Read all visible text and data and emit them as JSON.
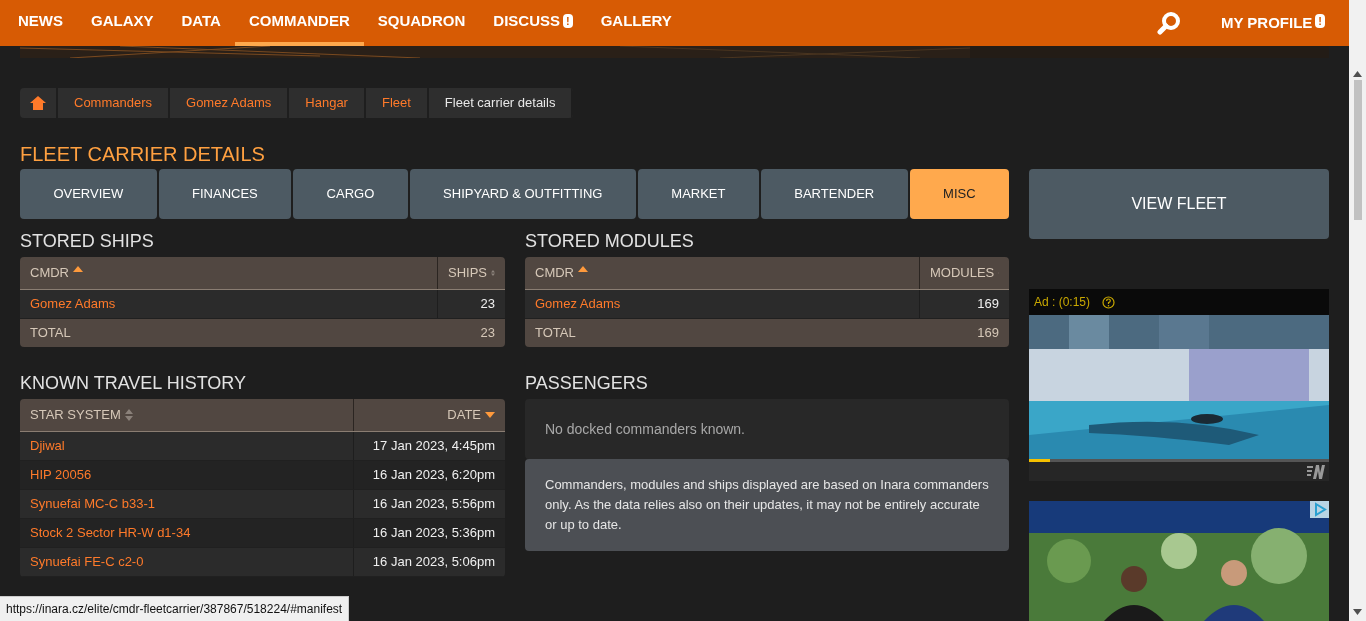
{
  "nav": {
    "items": [
      {
        "label": "NEWS",
        "selected": false,
        "alert": false
      },
      {
        "label": "GALAXY",
        "selected": false,
        "alert": false
      },
      {
        "label": "DATA",
        "selected": false,
        "alert": false
      },
      {
        "label": "COMMANDER",
        "selected": true,
        "alert": false
      },
      {
        "label": "SQUADRON",
        "selected": false,
        "alert": false
      },
      {
        "label": "DISCUSS",
        "selected": false,
        "alert": true
      },
      {
        "label": "GALLERY",
        "selected": false,
        "alert": false
      }
    ],
    "alert_mark": "!",
    "profile": {
      "label": "MY PROFILE",
      "alert": true
    }
  },
  "breadcrumb": [
    {
      "label": "Commanders",
      "current": false
    },
    {
      "label": "Gomez Adams",
      "current": false
    },
    {
      "label": "Hangar",
      "current": false
    },
    {
      "label": "Fleet",
      "current": false
    },
    {
      "label": "Fleet carrier details",
      "current": true
    }
  ],
  "page_title": "FLEET CARRIER DETAILS",
  "tabs": [
    {
      "label": "OVERVIEW",
      "selected": false
    },
    {
      "label": "FINANCES",
      "selected": false
    },
    {
      "label": "CARGO",
      "selected": false
    },
    {
      "label": "SHIPYARD & OUTFITTING",
      "selected": false
    },
    {
      "label": "MARKET",
      "selected": false
    },
    {
      "label": "BARTENDER",
      "selected": false
    },
    {
      "label": "MISC",
      "selected": true
    }
  ],
  "view_fleet_button": "VIEW FLEET",
  "stored_ships": {
    "title": "STORED SHIPS",
    "columns": [
      {
        "label": "CMDR",
        "sorted": true,
        "descending": false
      },
      {
        "label": "SHIPS",
        "sorted": false
      }
    ],
    "rows": [
      [
        "Gomez Adams",
        "23"
      ]
    ],
    "total": [
      "TOTAL",
      "23"
    ]
  },
  "stored_modules": {
    "title": "STORED MODULES",
    "columns": [
      {
        "label": "CMDR",
        "sorted": true,
        "descending": false
      },
      {
        "label": "MODULES",
        "sorted": false
      }
    ],
    "rows": [
      [
        "Gomez Adams",
        "169"
      ]
    ],
    "total": [
      "TOTAL",
      "169"
    ]
  },
  "travel_history": {
    "title": "KNOWN TRAVEL HISTORY",
    "columns": [
      {
        "label": "STAR SYSTEM",
        "sorted": false
      },
      {
        "label": "DATE",
        "sorted": true,
        "descending": true
      }
    ],
    "rows": [
      [
        "Djiwal",
        "17 Jan 2023, 4:45pm"
      ],
      [
        "HIP 20056",
        "16 Jan 2023, 6:20pm"
      ],
      [
        "Synuefai MC-C b33-1",
        "16 Jan 2023, 5:56pm"
      ],
      [
        "Stock 2 Sector HR-W d1-34",
        "16 Jan 2023, 5:36pm"
      ],
      [
        "Synuefai FE-C c2-0",
        "16 Jan 2023, 5:06pm"
      ]
    ]
  },
  "passengers": {
    "title": "PASSENGERS",
    "empty_text": "No docked commanders known."
  },
  "note": "Commanders, modules and ships displayed are based on Inara commanders only. As the data relies also on their updates, it may not be entirely accurate or up to date.",
  "video_ad": {
    "label": "Ad : (0:15)",
    "level": 0.07
  },
  "status_url": "https://inara.cz/elite/cmdr-fleetcarrier/387867/518224/#manifest"
}
